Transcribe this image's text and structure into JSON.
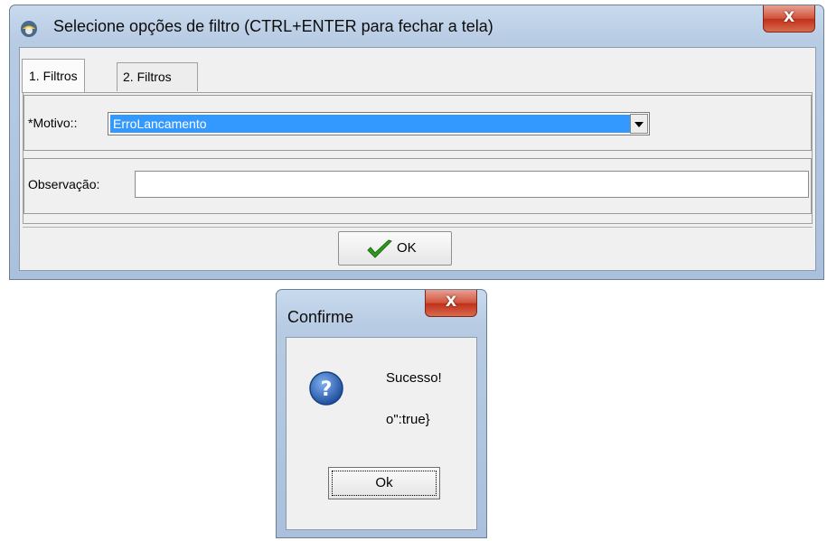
{
  "main_window": {
    "title": "Selecione opções de filtro (CTRL+ENTER para fechar a tela)",
    "close_glyph": "X",
    "tabs": [
      {
        "label": "1. Filtros",
        "active": true
      },
      {
        "label": "2. Filtros",
        "active": false
      }
    ],
    "motivo": {
      "label": "*Motivo::",
      "value": "ErroLancamento"
    },
    "observacao": {
      "label": "Observação:",
      "value": ""
    },
    "ok_button": {
      "label": "OK",
      "icon": "checkmark-icon"
    }
  },
  "dialog": {
    "title": "Confirme",
    "close_glyph": "X",
    "icon": "question-icon",
    "message": "Sucesso!",
    "detail": "o\":true}",
    "ok_label": "Ok"
  },
  "colors": {
    "selection": "#3399ff",
    "close_red": "#c0301b",
    "check_green": "#2d9a1e",
    "question_blue": "#2f5fb0"
  }
}
